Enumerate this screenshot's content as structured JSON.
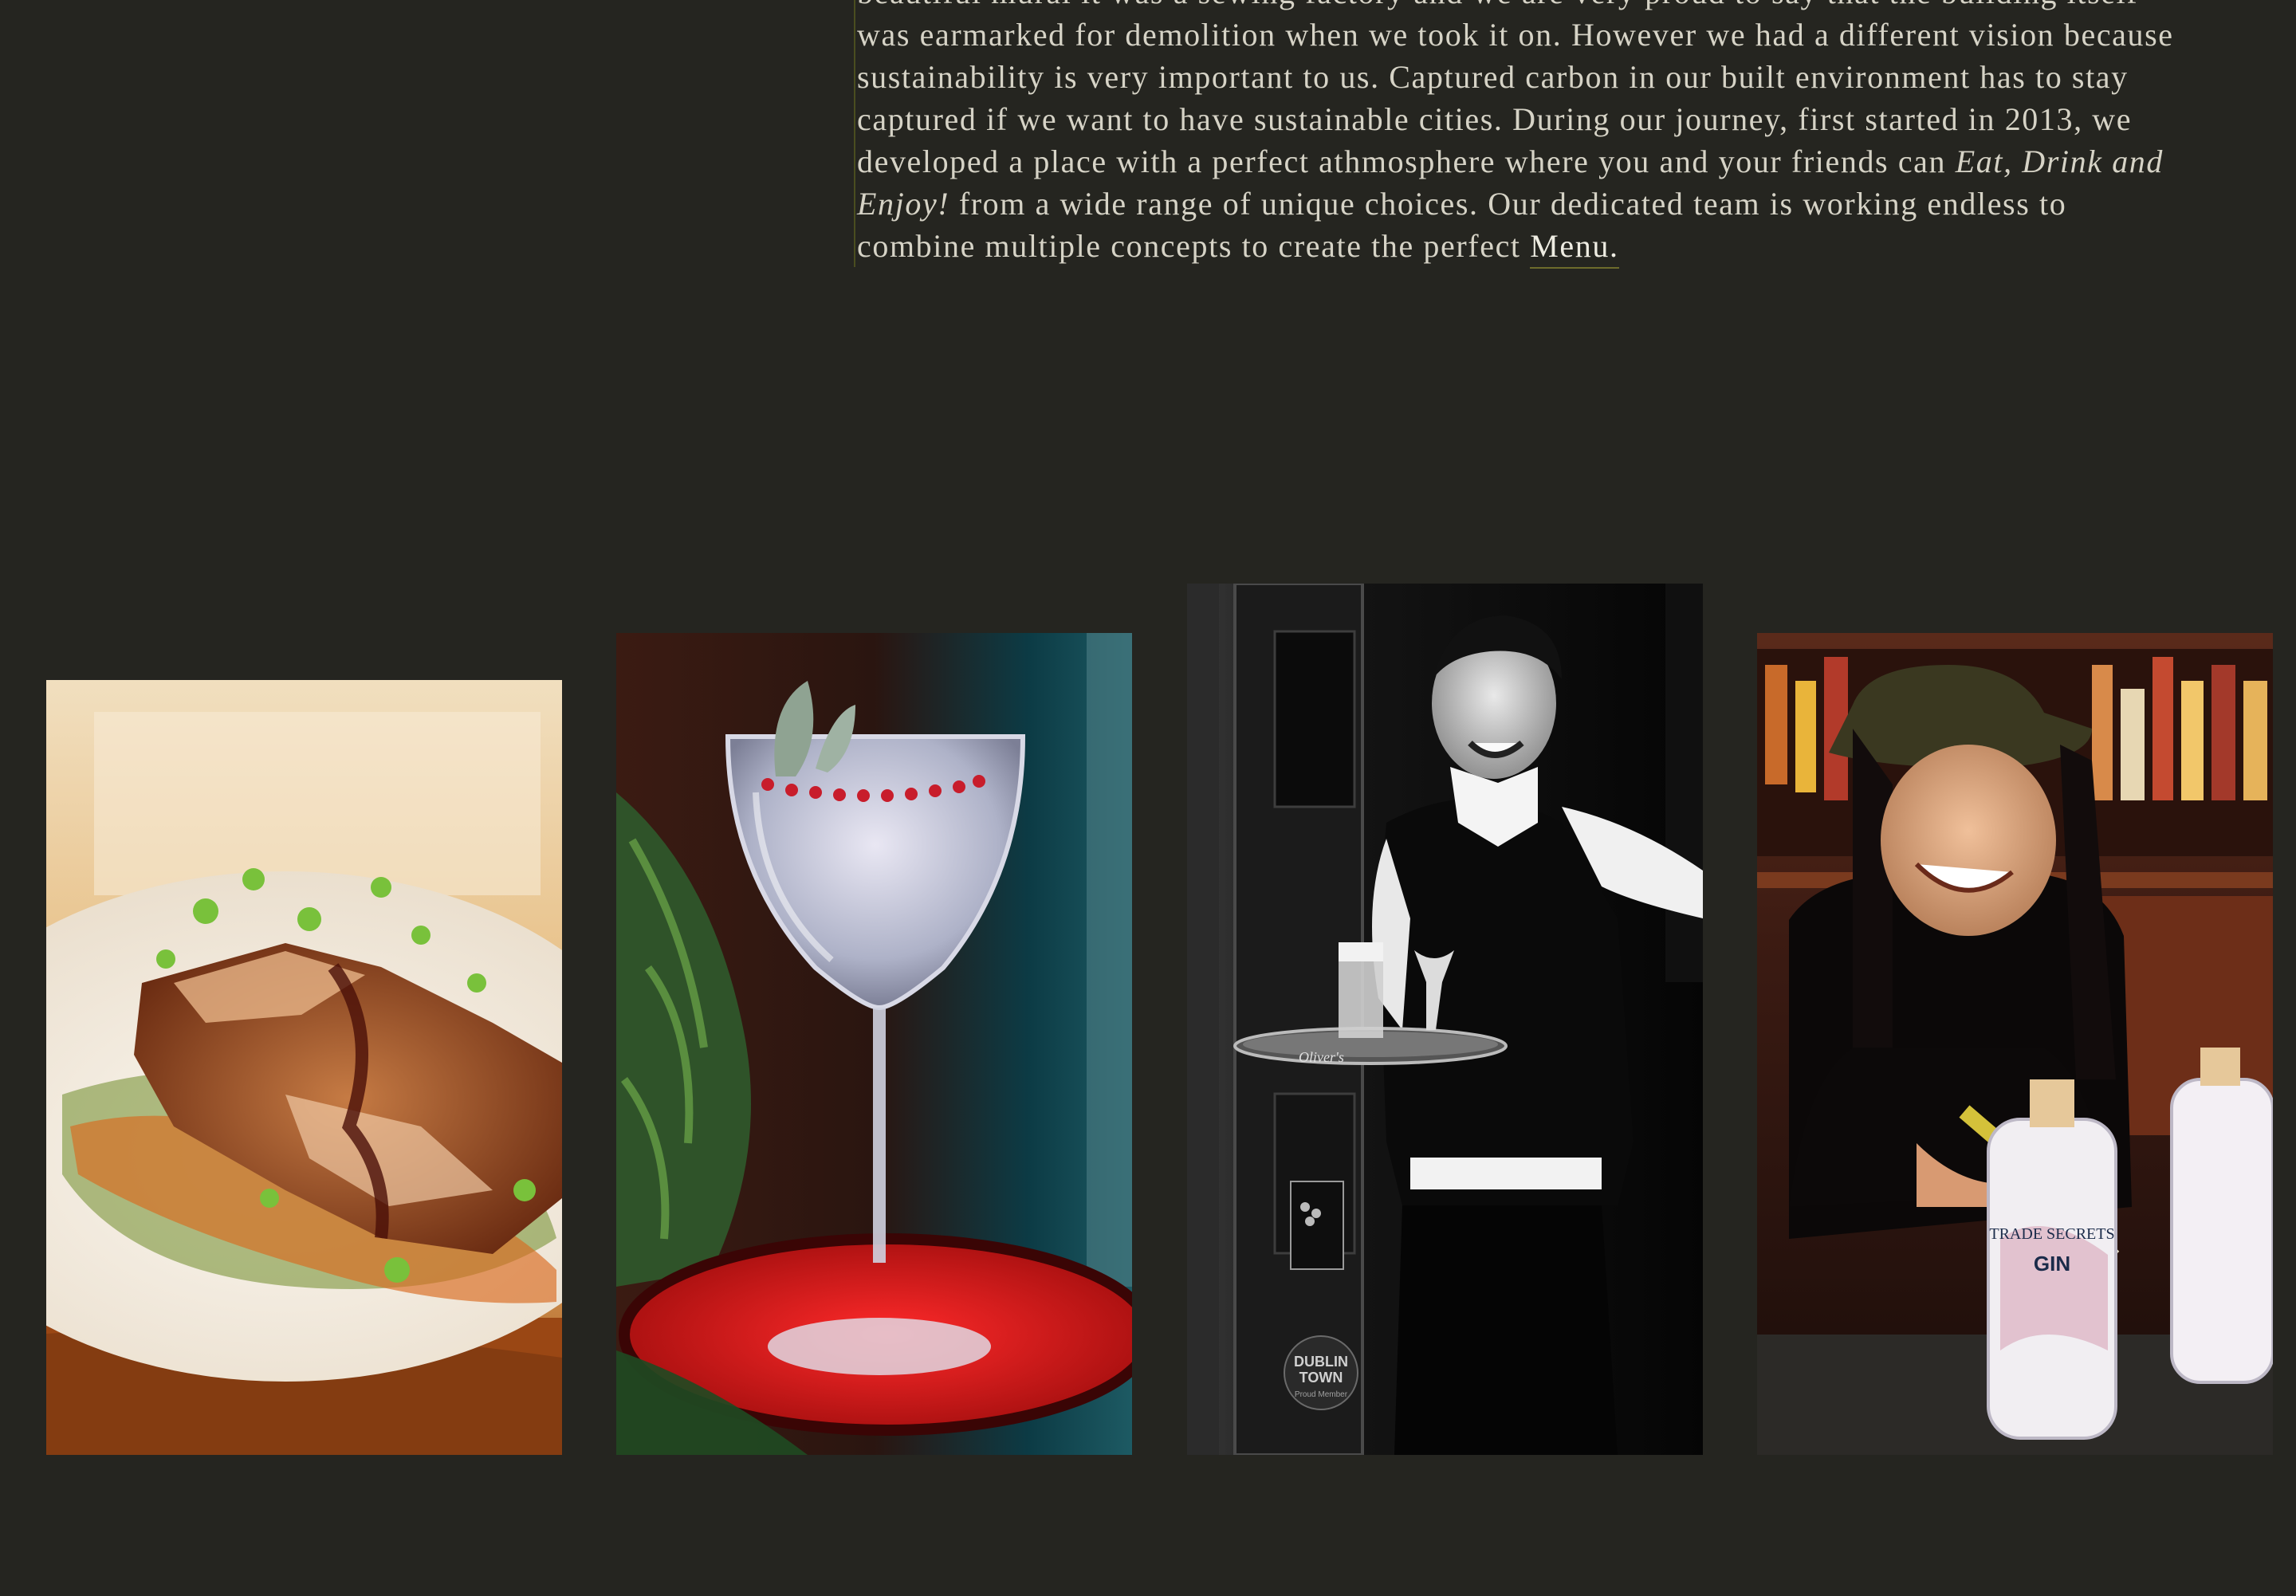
{
  "about": {
    "line_0": "beautiful mural it was a sewing factory and we are very proud to say that the building itself",
    "line_1": "was earmarked for demolition when we took it on. However we had a different vision because",
    "line_2": "sustainability is very important to us. Captured carbon in our built environment has to stay",
    "line_3": "captured if we want to have sustainable cities. During our journey, first started in 2013, we",
    "line_4_before": "developed a place with a perfect athmosphere where you and your friends can ",
    "emphasis_part1": "Eat, Drink and",
    "emphasis_part2": "Enjoy!",
    "line_5_after": " from a wide range of unique choices. Our dedicated team is working endless to",
    "line_6_before": "combine multiple concepts to create the perfect ",
    "menu_link": "Menu."
  },
  "photos": {
    "food": {
      "label": ""
    },
    "drink": {
      "label": ""
    },
    "waiter": {
      "tray_logo": "Oliver's",
      "badge_line1": "DUBLIN",
      "badge_line2": "TOWN",
      "badge_line3": "Proud Member"
    },
    "gin": {
      "bottle_brand": "TRADE SECRETS",
      "bottle_label": "GIN"
    }
  },
  "colors": {
    "background": "#252520",
    "text": "#d6d3c6",
    "accent_border": "#4a4d1f",
    "link_underline": "#6d6b2b"
  }
}
